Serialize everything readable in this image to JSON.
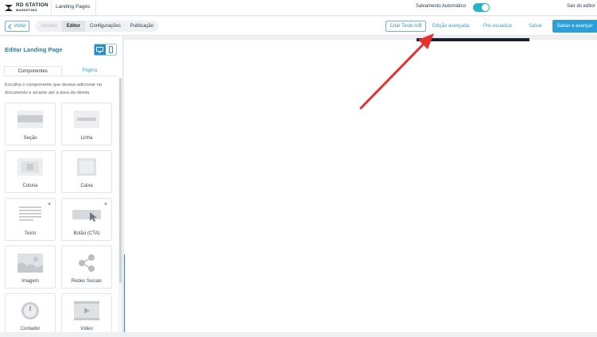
{
  "header": {
    "logo_line1": "RD STATION",
    "logo_line2": "MARKETING",
    "title": "Landing Pages",
    "autosave_label": "Salvamento Automático",
    "autosave_on": true,
    "exit_label": "Sair do editor"
  },
  "toolbar": {
    "back_label": "Voltar",
    "steps": [
      {
        "label": "Modelo",
        "state": "done"
      },
      {
        "label": "Editor",
        "state": "active"
      },
      {
        "label": "Configurações",
        "state": "todo"
      },
      {
        "label": "Publicação",
        "state": "todo"
      }
    ],
    "ab_test_label": "Criar Teste A/B",
    "advanced_edit_label": "Edição avançada",
    "preview_label": "Pré-visualizar",
    "save_label": "Salvar",
    "save_next_label": "Salvar e avançar"
  },
  "sidebar": {
    "title": "Editar Landing Page",
    "tabs": [
      {
        "label": "Componentes",
        "active": true
      },
      {
        "label": "Página",
        "active": false
      }
    ],
    "instructions": "Escolha o componente que deseja adicionar no documento e arraste até a área da direita",
    "components": [
      {
        "label": "Seção",
        "icon": "section-icon"
      },
      {
        "label": "Linha",
        "icon": "line-icon"
      },
      {
        "label": "Coluna",
        "icon": "column-icon"
      },
      {
        "label": "Caixa",
        "icon": "box-icon"
      },
      {
        "label": "Texto",
        "icon": "text-icon",
        "new": true
      },
      {
        "label": "Botão (CTA)",
        "icon": "button-icon",
        "new": true
      },
      {
        "label": "Imagem",
        "icon": "image-icon"
      },
      {
        "label": "Redes Sociais",
        "icon": "social-icon"
      },
      {
        "label": "Contador",
        "icon": "counter-icon"
      },
      {
        "label": "Vídeo",
        "icon": "video-icon"
      }
    ]
  },
  "colors": {
    "accent": "#2a9fd8",
    "link": "#3a9ec8",
    "toggle": "#28b4c8",
    "annotation": "#e8312f"
  }
}
